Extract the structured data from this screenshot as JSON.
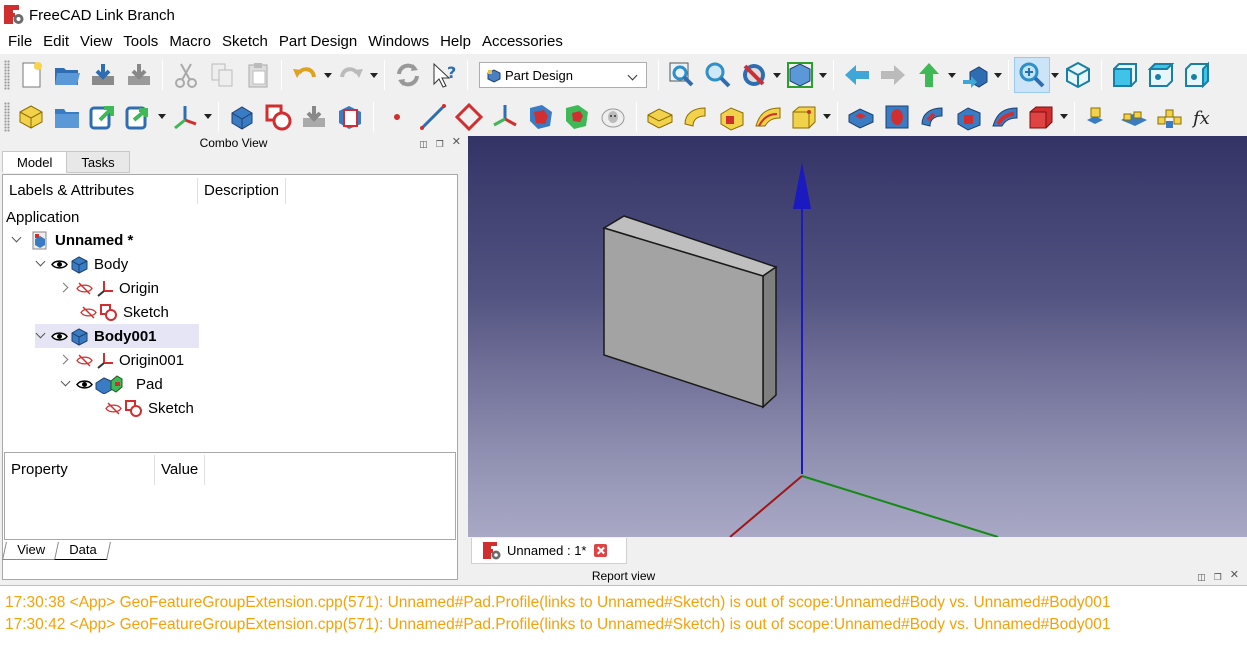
{
  "window": {
    "title": "FreeCAD Link Branch"
  },
  "menu": [
    "File",
    "Edit",
    "View",
    "Tools",
    "Macro",
    "Sketch",
    "Part Design",
    "Windows",
    "Help",
    "Accessories"
  ],
  "workbench_selector": {
    "value": "Part Design"
  },
  "combo_view": {
    "title": "Combo View",
    "tabs": [
      "Model",
      "Tasks"
    ],
    "tree_columns": [
      "Labels & Attributes",
      "Description"
    ],
    "root": "Application",
    "items": [
      {
        "label": "Unnamed *",
        "bold": true
      },
      {
        "label": "Body"
      },
      {
        "label": "Origin"
      },
      {
        "label": "Sketch"
      },
      {
        "label": "Body001",
        "bold": true
      },
      {
        "label": "Origin001"
      },
      {
        "label": "Pad"
      },
      {
        "label": "Sketch"
      }
    ],
    "property_columns": [
      "Property",
      "Value"
    ],
    "bottom_tabs": [
      "View",
      "Data"
    ]
  },
  "document_tab": {
    "label": "Unnamed : 1*"
  },
  "report_view": {
    "title": "Report view",
    "lines": [
      "17:30:38  <App> GeoFeatureGroupExtension.cpp(571): Unnamed#Pad.Profile(links to Unnamed#Sketch) is out of scope:Unnamed#Body vs. Unnamed#Body001",
      "17:30:42  <App> GeoFeatureGroupExtension.cpp(571): Unnamed#Pad.Profile(links to Unnamed#Sketch) is out of scope:Unnamed#Body vs. Unnamed#Body001"
    ]
  },
  "colors": {
    "report_text": "#f5a10a",
    "viewport_top": "#333366",
    "viewport_bottom": "#a9a9c6",
    "axis_x": "#cc0000",
    "axis_y": "#008800",
    "axis_z": "#0000cc"
  },
  "icons": [
    "new-icon",
    "open-icon",
    "save-icon",
    "save-as-icon",
    "cut-icon",
    "copy-icon",
    "paste-icon",
    "undo-icon",
    "redo-icon",
    "refresh-icon",
    "whats-this-icon",
    "fit-all-icon",
    "fit-selection-icon",
    "draw-style-icon",
    "bounding-box-icon",
    "back-icon",
    "forward-icon",
    "up-icon",
    "workbench-icon",
    "zoom-icon",
    "isometric-icon",
    "front-icon",
    "top-icon",
    "right-icon"
  ]
}
